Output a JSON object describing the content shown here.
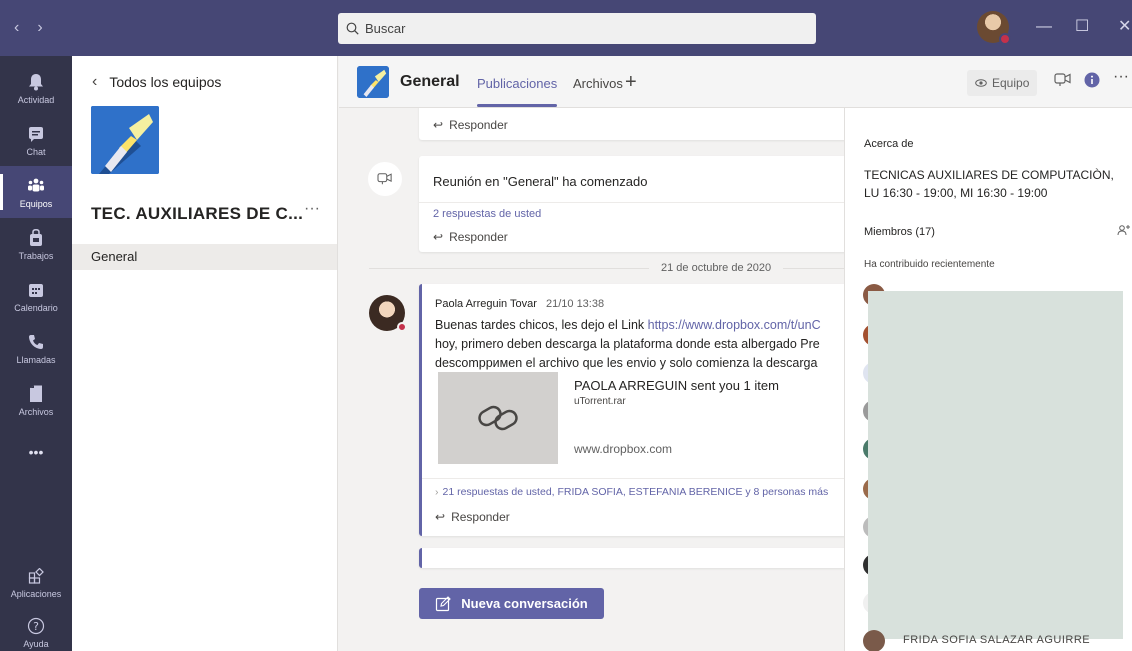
{
  "titlebar": {
    "search_placeholder": "Buscar",
    "back_arrow": "‹",
    "forward_arrow": "›"
  },
  "rail": {
    "items": [
      {
        "label": "Actividad",
        "icon": "bell-icon"
      },
      {
        "label": "Chat",
        "icon": "chat-icon"
      },
      {
        "label": "Equipos",
        "icon": "teams-icon"
      },
      {
        "label": "Trabajos",
        "icon": "bag-icon"
      },
      {
        "label": "Calendario",
        "icon": "calendar-icon"
      },
      {
        "label": "Llamadas",
        "icon": "phone-icon"
      },
      {
        "label": "Archivos",
        "icon": "file-icon"
      }
    ],
    "more": "•••",
    "apps_label": "Aplicaciones",
    "help_label": "Ayuda"
  },
  "teampane": {
    "back_label": "Todos los equipos",
    "team_name": "TEC. AUXILIARES DE C...",
    "more": "···",
    "channels": [
      "General"
    ]
  },
  "channel_header": {
    "name": "General",
    "tabs": [
      "Publicaciones",
      "Archivos"
    ],
    "add_tab": "+",
    "team_button": "Equipo",
    "more": "···"
  },
  "feed": {
    "reply_label": "Responder",
    "meeting_text": "Reunión en \"General\" ha comenzado",
    "meeting_replies": "2 respuestas de usted",
    "date_separator": "21 de octubre de 2020",
    "post": {
      "author": "Paola Arreguin Tovar",
      "timestamp": "21/10 13:38",
      "line1_text": "Buenas tardes chicos, les dejo el Link ",
      "line1_link": "https://www.dropbox.com/t/unC",
      "line2": "hoy, primero deben descarga la plataforma donde esta albergado Pre",
      "line3": "descompримen el archivo que les envio y solo comienza la descarga",
      "preview_title": "PAOLA ARREGUIN sent you 1 item",
      "preview_file": "uTorrent.rar",
      "preview_domain": "www.dropbox.com",
      "replies": "21 respuestas de usted, FRIDA SOFIA, ESTEFANIA BERENICE y 8 personas más"
    },
    "new_conversation": "Nueva conversación"
  },
  "infopane": {
    "about_heading": "Acerca de",
    "description": "TECNICAS AUXILIARES DE COMPUTACIÒN, LU 16:30 - 19:00, MI 16:30 - 19:00",
    "members_heading": "Miembros (17)",
    "contributed_heading": "Ha contribuido recientemente",
    "last_member": "FRIDA SOFIA SALAZAR AGUIRRE"
  },
  "colors": {
    "titlebar": "#464775",
    "rail": "#33344a",
    "accent": "#6264a7",
    "status_busy": "#c4314b"
  }
}
